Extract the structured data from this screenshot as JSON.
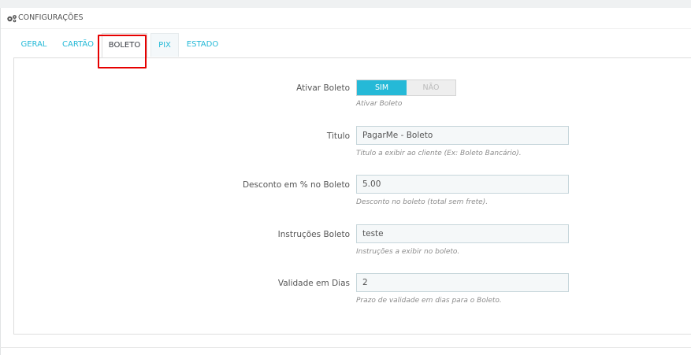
{
  "panel": {
    "title": "CONFIGURAÇÕES",
    "icon": "cogs-icon"
  },
  "tabs": [
    {
      "label": "GERAL",
      "active": false
    },
    {
      "label": "CARTÃO",
      "active": false
    },
    {
      "label": "BOLETO",
      "active": true
    },
    {
      "label": "PIX",
      "active": false
    },
    {
      "label": "ESTADO",
      "active": false
    }
  ],
  "form": {
    "ativar": {
      "label": "Ativar Boleto",
      "on_label": "SIM",
      "off_label": "NÃO",
      "value": "SIM",
      "help": "Ativar Boleto"
    },
    "titulo": {
      "label": "Titulo",
      "value": "PagarMe - Boleto",
      "help": "Titulo a exibir ao cliente (Ex: Boleto Bancário)."
    },
    "desconto": {
      "label": "Desconto em % no Boleto",
      "value": "5.00",
      "help": "Desconto no boleto (total sem frete)."
    },
    "instrucoes": {
      "label": "Instruções Boleto",
      "value": "teste",
      "help": "Instruções a exibir no boleto."
    },
    "validade": {
      "label": "Validade em Dias",
      "value": "2",
      "help": "Prazo de validade em dias para o Boleto."
    }
  },
  "colors": {
    "accent": "#25b9d7",
    "highlight": "#e60000"
  }
}
